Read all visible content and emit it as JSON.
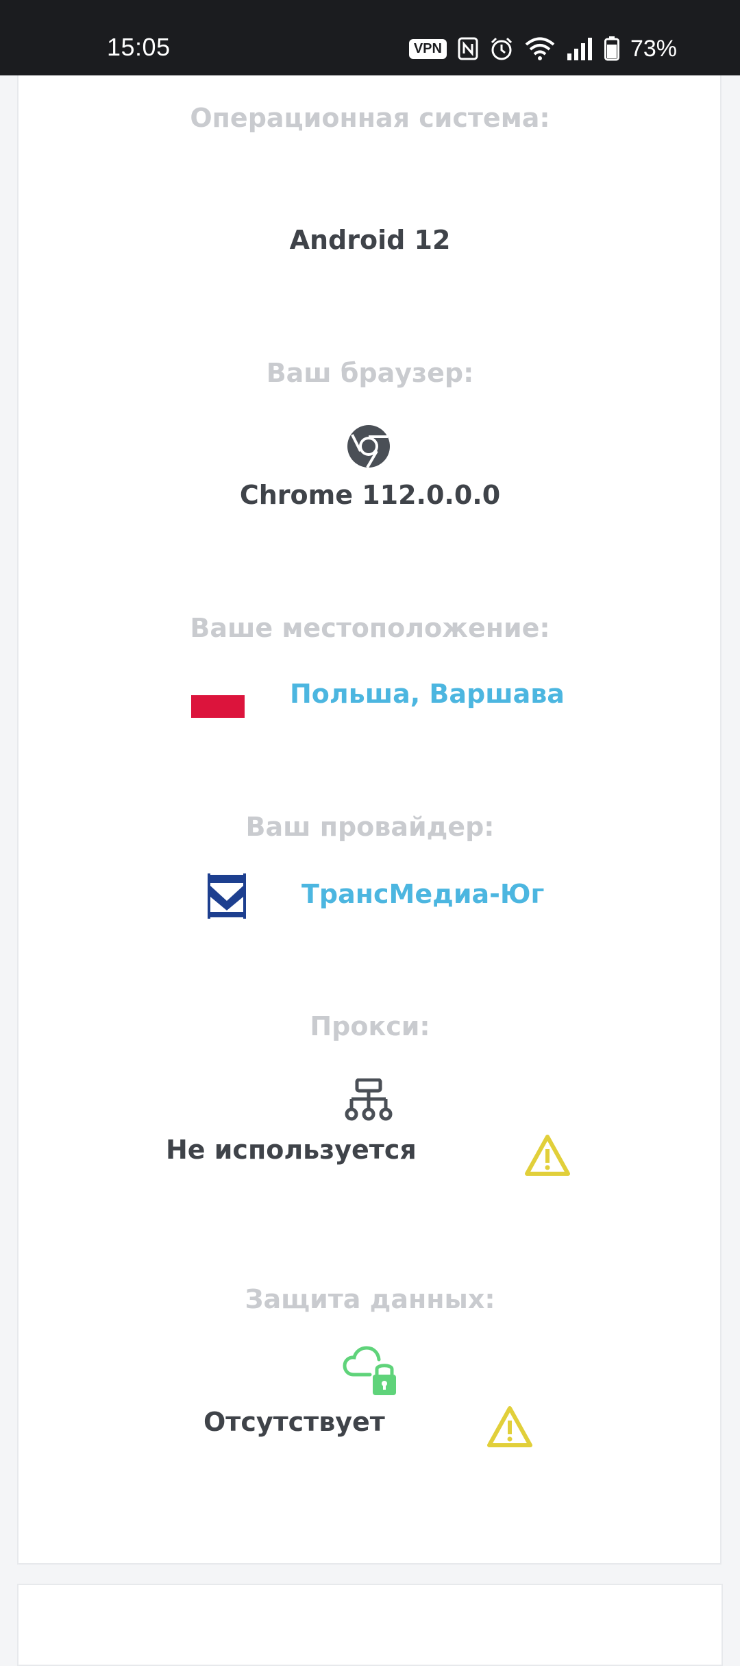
{
  "status_bar": {
    "time": "15:05",
    "vpn": "VPN",
    "battery": "73%",
    "icons": [
      "vpn-icon",
      "nfc-icon",
      "alarm-icon",
      "wifi-icon",
      "signal-icon",
      "battery-icon"
    ]
  },
  "sections": {
    "os": {
      "label": "Операционная система:",
      "value": "Android 12"
    },
    "browser": {
      "label": "Ваш браузер:",
      "value": "Chrome 112.0.0.0",
      "icon": "chrome-icon"
    },
    "location": {
      "label": "Ваше местоположение:",
      "value": "Польша, Варшава",
      "icon": "poland-flag-icon"
    },
    "provider": {
      "label": "Ваш провайдер:",
      "value": "ТрансМедиа-Юг",
      "icon": "provider-logo"
    },
    "proxy": {
      "label": "Прокси:",
      "value": "Не используется",
      "icon": "network-icon",
      "warning_icon": "warning-icon"
    },
    "data_protection": {
      "label": "Защита данных:",
      "value": "Отсутствует",
      "icon": "cloud-lock-icon",
      "warning_icon": "warning-icon"
    }
  },
  "colors": {
    "label": "#c9cbcf",
    "value": "#3f4349",
    "link": "#4cb6e0",
    "warning": "#e1cf3a",
    "secure": "#5fd37a",
    "flag_red": "#dc143c"
  }
}
